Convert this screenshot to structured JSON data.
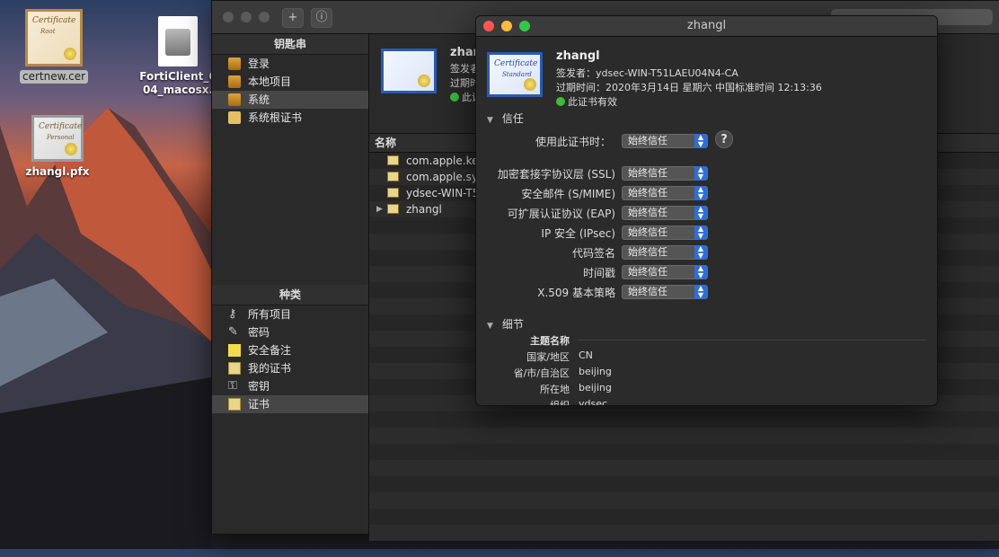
{
  "desktop": {
    "icons": [
      {
        "label": "certnew.cer",
        "cert_word": "Certificate",
        "cert_sub": "Root"
      },
      {
        "label_line1": "FortiClient_6",
        "label_line2": "04_macosx."
      },
      {
        "label": "zhangl.pfx",
        "cert_word": "Certificate",
        "cert_sub": "Personal"
      }
    ]
  },
  "keychain": {
    "toolbar": {
      "add_symbol": "+",
      "info_symbol": "ⓘ"
    },
    "sidebar": {
      "keychains_header": "钥匙串",
      "keychains": [
        "登录",
        "本地项目",
        "系统",
        "系统根证书"
      ],
      "selected_keychain": "系统",
      "category_header": "种类",
      "categories": [
        "所有项目",
        "密码",
        "安全备注",
        "我的证书",
        "密钥",
        "证书"
      ],
      "selected_category": "证书"
    },
    "info_partial": {
      "name": "zhar",
      "issuer": "签发者",
      "expiry": "过期时",
      "valid": "此证"
    },
    "list": {
      "column_name": "名称",
      "rows": [
        "com.apple.kerl",
        "com.apple.syst",
        "ydsec-WIN-T5",
        "zhangl"
      ]
    }
  },
  "detail": {
    "window_title": "zhangl",
    "cert_word": "Certificate",
    "cert_sub": "Standard",
    "name": "zhangl",
    "issuer": "签发者：ydsec-WIN-T51LAEU04N4-CA",
    "expiry": "过期时间：2020年3月14日 星期六 中国标准时间 12:13:36",
    "valid_text": "此证书有效",
    "trust": {
      "title": "信任",
      "when_using_label": "使用此证书时：",
      "when_using_value": "始终信任",
      "help_symbol": "?",
      "items": [
        {
          "label": "加密套接字协议层 (SSL)",
          "value": "始终信任"
        },
        {
          "label": "安全邮件 (S/MIME)",
          "value": "始终信任"
        },
        {
          "label": "可扩展认证协议 (EAP)",
          "value": "始终信任"
        },
        {
          "label": "IP 安全 (IPsec)",
          "value": "始终信任"
        },
        {
          "label": "代码签名",
          "value": "始终信任"
        },
        {
          "label": "时间戳",
          "value": "始终信任"
        },
        {
          "label": "X.509 基本策略",
          "value": "始终信任"
        }
      ]
    },
    "details": {
      "title": "细节",
      "subject_name_label": "主题名称",
      "rows": [
        {
          "label": "国家/地区",
          "value": "CN"
        },
        {
          "label": "省/市/自治区",
          "value": "beijing"
        },
        {
          "label": "所在地",
          "value": "beijing"
        },
        {
          "label": "组织",
          "value": "ydsec"
        }
      ]
    },
    "colors": {
      "close": "#fc5753",
      "minimize": "#fdbc40",
      "zoom": "#33c748",
      "popup_accent": "#2d6fd6",
      "valid_green": "#3dbb3d"
    }
  }
}
